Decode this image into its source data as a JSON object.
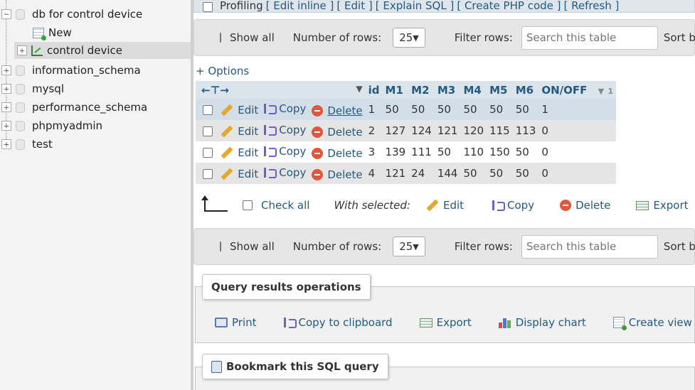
{
  "tree": {
    "items": [
      {
        "label": "db for control device",
        "toggle": "−"
      },
      {
        "label": "New"
      },
      {
        "label": "control device",
        "toggle": "+"
      },
      {
        "label": "information_schema",
        "toggle": "+"
      },
      {
        "label": "mysql",
        "toggle": "+"
      },
      {
        "label": "performance_schema",
        "toggle": "+"
      },
      {
        "label": "phpmyadmin",
        "toggle": "+"
      },
      {
        "label": "test",
        "toggle": "+"
      }
    ]
  },
  "profiling": {
    "label": "Profiling",
    "links": [
      "[ Edit inline ]",
      "[ Edit ]",
      "[ Explain SQL ]",
      "[ Create PHP code ]",
      "[ Refresh ]"
    ]
  },
  "nav": {
    "show_all": "Show all",
    "rows_label": "Number of rows:",
    "rows_value": "25",
    "filter_label": "Filter rows:",
    "search_placeholder": "Search this table",
    "sort_label": "Sort by"
  },
  "options_link": "+ Options",
  "table": {
    "columns": [
      "id",
      "M1",
      "M2",
      "M3",
      "M4",
      "M5",
      "M6",
      "ON/OFF"
    ],
    "sort_indicator": "1",
    "edit_label": "Edit",
    "copy_label": "Copy",
    "delete_label": "Delete",
    "rows": [
      [
        "1",
        "50",
        "50",
        "50",
        "50",
        "50",
        "50",
        "1"
      ],
      [
        "2",
        "127",
        "124",
        "121",
        "120",
        "115",
        "113",
        "0"
      ],
      [
        "3",
        "139",
        "111",
        "50",
        "110",
        "150",
        "50",
        "0"
      ],
      [
        "4",
        "121",
        "24",
        "144",
        "50",
        "50",
        "50",
        "0"
      ]
    ]
  },
  "with_selected": {
    "check_all": "Check all",
    "label": "With selected:",
    "edit": "Edit",
    "copy": "Copy",
    "delete": "Delete",
    "export": "Export"
  },
  "query_ops": {
    "title": "Query results operations",
    "print": "Print",
    "copy_clipboard": "Copy to clipboard",
    "export": "Export",
    "display_chart": "Display chart",
    "create_view": "Create view"
  },
  "bookmark": {
    "title": "Bookmark this SQL query"
  },
  "colors": {
    "link": "#235a81",
    "header_bg": "#dbe4ea",
    "selected_row": "#d2dfe8",
    "delete_red": "#e0573f"
  }
}
